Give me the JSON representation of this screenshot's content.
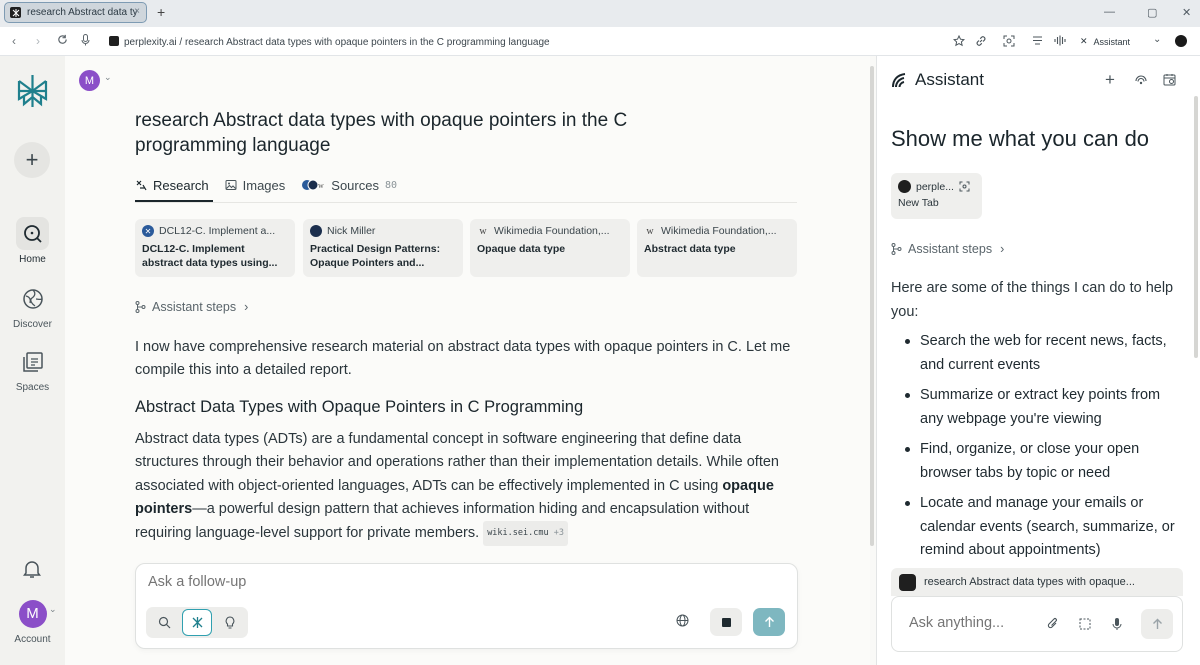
{
  "browser": {
    "tab_title": "research Abstract data types with opaque pointers in the C programming language",
    "url": "perplexity.ai / research Abstract data types with opaque pointers in the C programming language",
    "assistant_button": "Assistant"
  },
  "rail": {
    "home": "Home",
    "discover": "Discover",
    "spaces": "Spaces",
    "account": "Account",
    "avatar_initial": "M"
  },
  "main": {
    "avatar_initial": "M",
    "title": "research Abstract data types with opaque pointers in the C programming language",
    "tabs": [
      {
        "label": "Research"
      },
      {
        "label": "Images"
      },
      {
        "label": "Sources",
        "count": "80"
      }
    ],
    "source_cards": [
      {
        "source": "DCL12-C. Implement a...",
        "title": "DCL12-C. Implement abstract data types using..."
      },
      {
        "source": "Nick Miller",
        "title": "Practical Design Patterns: Opaque Pointers and..."
      },
      {
        "source": "Wikimedia Foundation,...",
        "title": "Opaque data type"
      },
      {
        "source": "Wikimedia Foundation,...",
        "title": "Abstract data type"
      }
    ],
    "steps_label": "Assistant steps",
    "intro": "I now have comprehensive research material on abstract data types with opaque pointers in C. Let me compile this into a detailed report.",
    "heading": "Abstract Data Types with Opaque Pointers in C Programming",
    "para_a": "Abstract data types (ADTs) are a fundamental concept in software engineering that define data structures through their behavior and operations rather than their implementation details. While often associated with object-oriented languages, ADTs can be effectively implemented in C using ",
    "para_bold": "opaque pointers",
    "para_b": "—a powerful design pattern that achieves information hiding and encapsulation without requiring language-level support for private members.",
    "citation": "wiki.sei.cmu",
    "citation_more": "+3",
    "followup_placeholder": "Ask a follow-up"
  },
  "assistant": {
    "title": "Assistant",
    "headline": "Show me what you can do",
    "context_site": "perple...",
    "context_tab": "New Tab",
    "steps_label": "Assistant steps",
    "intro": "Here are some of the things I can do to help you:",
    "capabilities": [
      "Search the web for recent news, facts, and current events",
      "Summarize or extract key points from any webpage you're viewing",
      "Find, organize, or close your open browser tabs by topic or need",
      "Locate and manage your emails or calendar events (search, summarize, or remind about appointments)"
    ],
    "tab_chip": "research Abstract data types with opaque...",
    "input_placeholder": "Ask anything..."
  },
  "colors": {
    "accent": "#20808d",
    "avatar": "#8b4fc8",
    "send": "#7eb7c0"
  }
}
